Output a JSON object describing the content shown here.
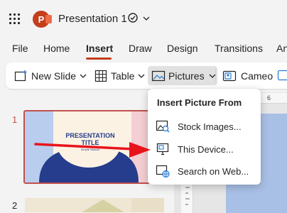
{
  "app": {
    "logo_letter": "P",
    "title": "Presentation 1"
  },
  "tabs": [
    {
      "label": "File"
    },
    {
      "label": "Home"
    },
    {
      "label": "Insert",
      "active": true
    },
    {
      "label": "Draw"
    },
    {
      "label": "Design"
    },
    {
      "label": "Transitions"
    },
    {
      "label": "An"
    }
  ],
  "toolbar": {
    "new_slide": "New Slide",
    "table": "Table",
    "pictures": "Pictures",
    "cameo": "Cameo"
  },
  "slides": {
    "items": [
      {
        "number": "1",
        "title_line1": "PRESENTATION",
        "title_line2": "TITLE",
        "subtitle": "Simple Nilsson"
      },
      {
        "number": "2"
      }
    ]
  },
  "ruler": {
    "top_mark": "6"
  },
  "picture_menu": {
    "header": "Insert Picture From",
    "items": [
      {
        "label": "Stock Images...",
        "icon": "stock-images-icon"
      },
      {
        "label": "This Device...",
        "icon": "this-device-icon"
      },
      {
        "label": "Search on Web...",
        "icon": "web-search-icon"
      }
    ]
  },
  "colors": {
    "brand": "#c43e1c",
    "slide_selected_border": "#c0504d",
    "annotation_arrow": "#e8141c"
  }
}
